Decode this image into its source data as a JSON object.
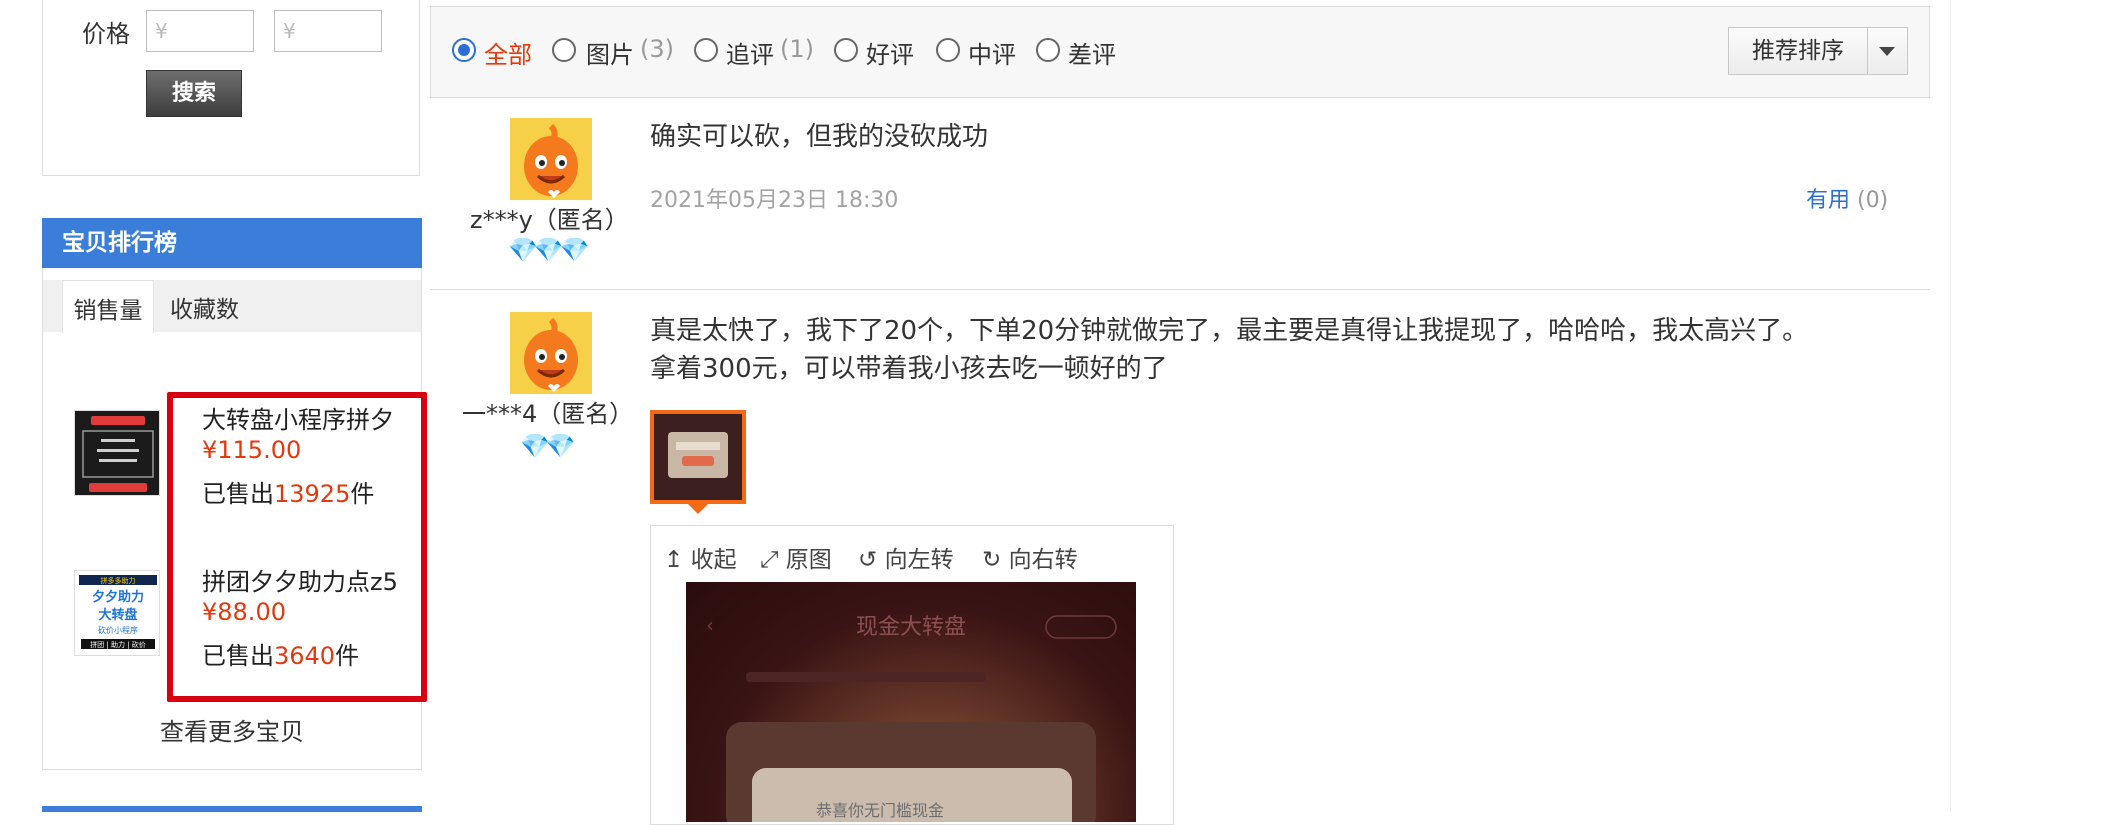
{
  "sidebar": {
    "price_label": "价格",
    "price_min_placeholder": "¥",
    "price_max_placeholder": "¥",
    "search_button": "搜索",
    "rank_title": "宝贝排行榜",
    "tabs": [
      "销售量",
      "收藏数"
    ],
    "products": [
      {
        "name": "大转盘小程序拼夕",
        "price": "¥115.00",
        "sold_prefix": "已售出",
        "sold_count": "13925",
        "sold_suffix": "件"
      },
      {
        "name": "拼团夕夕助力点z5",
        "price": "¥88.00",
        "sold_prefix": "已售出",
        "sold_count": "3640",
        "sold_suffix": "件"
      }
    ],
    "thumb2_lines": [
      "拼多多助力",
      "夕夕助力",
      "大转盘",
      "砍价小程序",
      "拼团 | 助力 | 砍价"
    ],
    "more_link": "查看更多宝贝"
  },
  "filters": {
    "options": [
      {
        "label": "全部",
        "count": "",
        "checked": true
      },
      {
        "label": "图片",
        "count": "(3)",
        "checked": false
      },
      {
        "label": "追评",
        "count": "(1)",
        "checked": false
      },
      {
        "label": "好评",
        "count": "",
        "checked": false
      },
      {
        "label": "中评",
        "count": "",
        "checked": false
      },
      {
        "label": "差评",
        "count": "",
        "checked": false
      }
    ],
    "sort_label": "推荐排序"
  },
  "reviews": [
    {
      "nick": "z***y（匿名）",
      "gems": "💎💎💎",
      "text": "确实可以砍，但我的没砍成功",
      "date": "2021年05月23日 18:30",
      "useful_label": "有用",
      "useful_count": "(0)"
    },
    {
      "nick": "一***4（匿名）",
      "gems": "💎💎",
      "text_line1": "真是太快了，我下了20个，下单20分钟就做完了，最主要是真得让我提现了，哈哈哈，我太高兴了。",
      "text_line2": "拿着300元，可以带着我小孩去吃一顿好的了"
    }
  ],
  "viewer": {
    "collapse": "收起",
    "original": "原图",
    "rotate_left": "向左转",
    "rotate_right": "向右转",
    "image_title": "现金大转盘",
    "image_caption": "恭喜你无门槛现金"
  },
  "colors": {
    "accent_orange": "#e4390f",
    "brand_blue": "#3b7ed9",
    "highlight_red": "#d7000f"
  }
}
